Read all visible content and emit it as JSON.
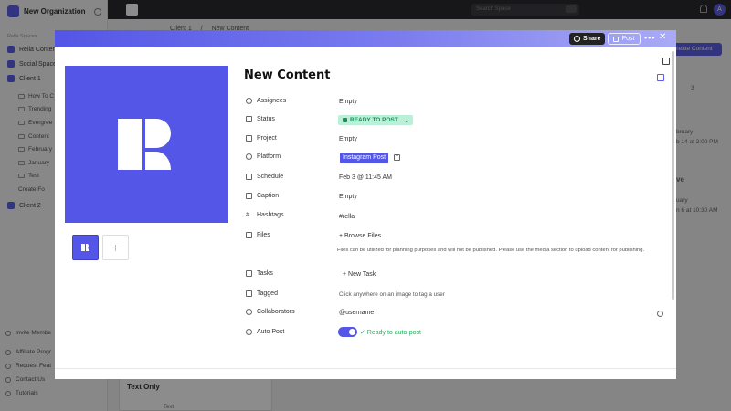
{
  "sidebar": {
    "org_name": "New Organization",
    "section_label": "Rella Spaces",
    "workspaces": [
      "Rella Content",
      "Social Space",
      "Client 1",
      "Client 2"
    ],
    "tree": [
      "How To C",
      "Trending",
      "Evergree",
      "Content",
      "February",
      "January",
      "Test",
      "Create Fo"
    ],
    "bottom": [
      "Invite Membe",
      "Affiliate Progr",
      "Request Feat",
      "Contact Us",
      "Tutorials"
    ]
  },
  "topbar": {
    "search_placeholder": "Search Space",
    "avatar": "A"
  },
  "background": {
    "breadcrumb_a": "Client 1",
    "breadcrumb_sep": "/",
    "breadcrumb_b": "New Content",
    "create_label": "reate Content",
    "card_title": "Text Only",
    "card_sub": "Text",
    "right_texts": [
      "bruary",
      "b 14 at 2:00 PM",
      "ve",
      "uary",
      "n 6 at 10:30 AM",
      "3"
    ]
  },
  "modal": {
    "share_label": "Share",
    "post_label": "Post",
    "more_label": "•••",
    "close_label": "✕",
    "title": "New Content",
    "add_media_label": "+",
    "properties": [
      {
        "label": "Assignees",
        "value": "Empty"
      },
      {
        "label": "Status",
        "value": "READY TO POST"
      },
      {
        "label": "Project",
        "value": "Empty"
      },
      {
        "label": "Platform",
        "value": "Instagram Post"
      },
      {
        "label": "Schedule",
        "value": "Feb 3  @  11:45 AM"
      },
      {
        "label": "Caption",
        "value": "Empty"
      },
      {
        "label": "Hashtags",
        "value": "#rella"
      },
      {
        "label": "Files",
        "value": "+ Browse Files"
      },
      {
        "label": "Tasks",
        "value": "+ New Task"
      },
      {
        "label": "Tagged",
        "value": "Click anywhere on an image to tag a user"
      },
      {
        "label": "Collaborators",
        "value": "@username"
      },
      {
        "label": "Auto Post",
        "value": "✓ Ready to auto-post"
      }
    ],
    "files_hint": "Files can be utilized for planning purposes and will not be published. Please use the media section to upload content for publishing.",
    "status_caret": "⌄",
    "platform_add": "+"
  },
  "colors": {
    "brand": "#5356e6",
    "status_bg": "#baf0d8",
    "status_text": "#1a8f5c",
    "autopost": "#1fb25a"
  }
}
